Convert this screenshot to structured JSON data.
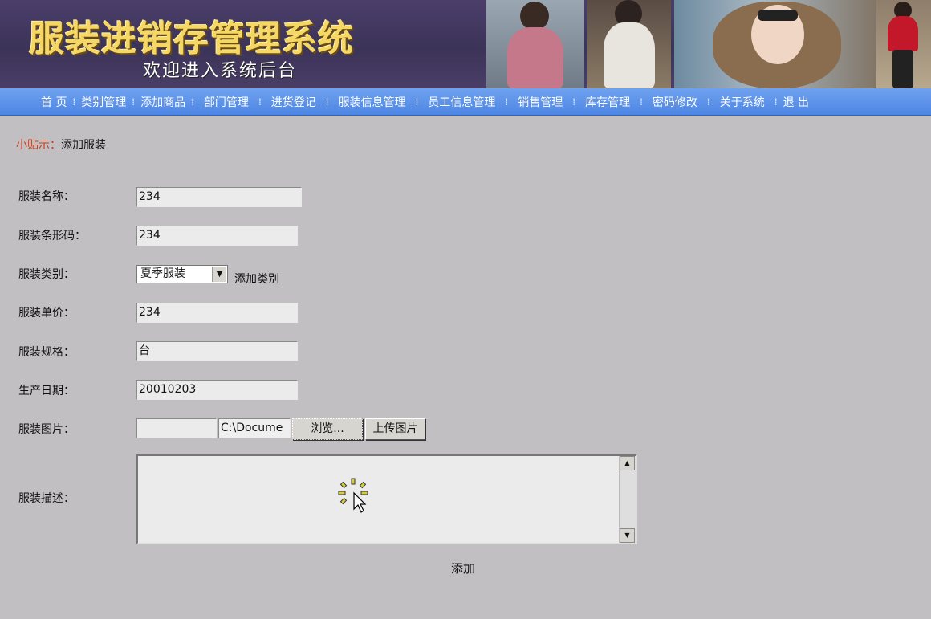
{
  "banner": {
    "title": "服装进销存管理系统",
    "subtitle": "欢迎进入系统后台"
  },
  "nav": {
    "items": [
      "首 页",
      "类别管理",
      "添加商品",
      "部门管理",
      "进货登记",
      "服装信息管理",
      "员工信息管理",
      "销售管理",
      "库存管理",
      "密码修改",
      "关于系统",
      "退 出"
    ]
  },
  "tip": {
    "label": "小贴示：",
    "text": "添加服装"
  },
  "form": {
    "name_label": "服装名称：",
    "name_value": "234",
    "barcode_label": "服装条形码：",
    "barcode_value": "234",
    "category_label": "服装类别：",
    "category_value": "夏季服装",
    "add_category": "添加类别",
    "price_label": "服装单价：",
    "price_value": "234",
    "spec_label": "服装规格：",
    "spec_value": "台",
    "date_label": "生产日期：",
    "date_value": "20010203",
    "image_label": "服装图片：",
    "image_path": "",
    "file_path": "C:\\Docume",
    "browse_button": "浏览...",
    "upload_button": "上传图片",
    "desc_label": "服装描述：",
    "submit": "添加"
  },
  "icons": {
    "busy_cursor": "busy-cursor-icon",
    "scroll_up": "scroll-up-icon",
    "scroll_down": "scroll-down-icon",
    "dropdown": "chevron-down-icon"
  },
  "colors": {
    "nav_bg": "#5a8fe8",
    "page_bg": "#c1bfc1",
    "banner_title": "#f5d766",
    "tip_label": "#c4401c"
  }
}
